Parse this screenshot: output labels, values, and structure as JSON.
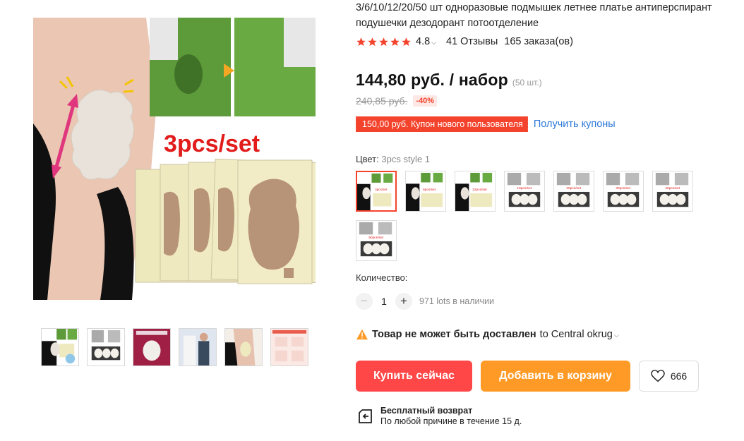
{
  "product": {
    "title": "3/6/10/12/20/50 шт одноразовые подмышек летнее платье антиперспирант подушечки дезодорант потоотделение",
    "main_image_text": "3pcs/set",
    "rating": "4.8",
    "reviews": "41 Отзывы",
    "orders": "165 заказа(ов)"
  },
  "price": {
    "current": "144,80 руб. / набор",
    "unit": "(50 шт.)",
    "old": "240,85 руб.",
    "discount": "-40%"
  },
  "coupon": {
    "badge": "150,00 руб. Купон нового пользователя",
    "link": "Получить купоны"
  },
  "color": {
    "label": "Цвет:",
    "value": "3pcs style 1",
    "swatch_texts": [
      "3pcs/set",
      "6pcs/set",
      "12pcs/set",
      "10pcs/set",
      "20pcs/set",
      "30pcs/set",
      "40pcs/set",
      "50pcs/set"
    ]
  },
  "quantity": {
    "label": "Количество:",
    "value": "1",
    "minus": "−",
    "plus": "+",
    "stock": "971 lots в наличии"
  },
  "delivery": {
    "warning": "Товар не может быть доставлен",
    "to": "to Central okrug"
  },
  "actions": {
    "buy": "Купить сейчас",
    "cart": "Добавить в корзину",
    "wishlist_count": "666"
  },
  "return": {
    "title": "Бесплатный возврат",
    "subtitle": "По любой причине в течение 15 д."
  },
  "colors": {
    "accent": "#ff4747",
    "orange": "#ff9a26",
    "link": "#2e7ad8",
    "star": "#f4432c"
  }
}
